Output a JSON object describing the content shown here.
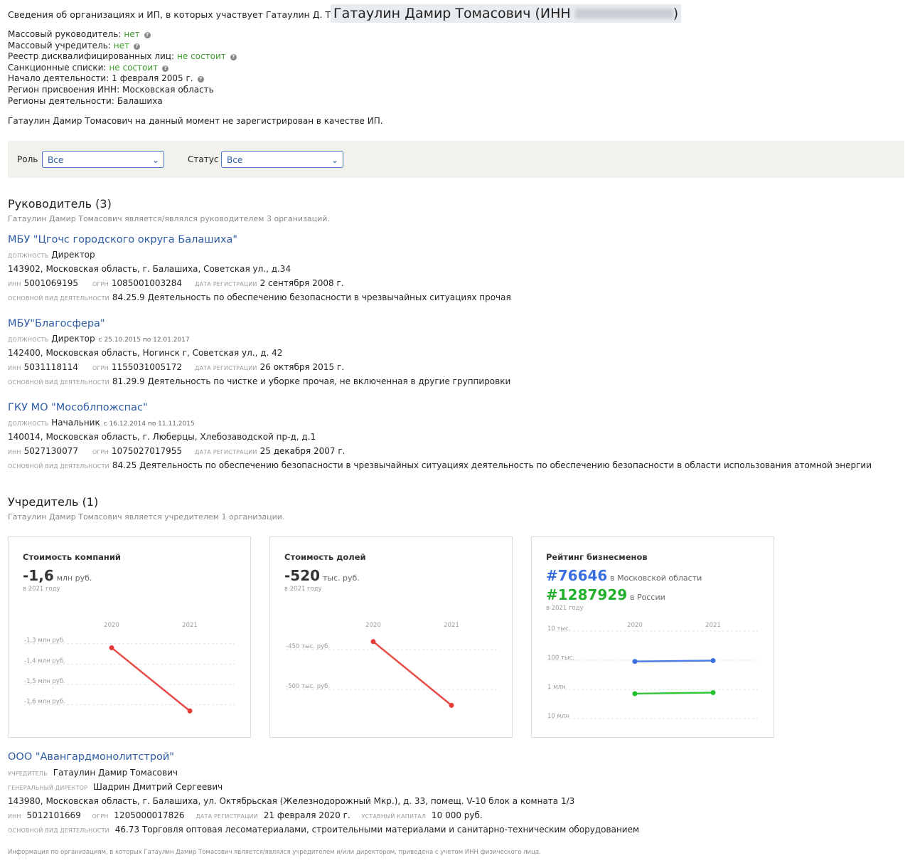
{
  "header": {
    "title": "Сведения об организациях и ИП, в которых участвует Гатаулин Д. Т.",
    "name_box": "Гатаулин Дамир Томасович (ИНН ",
    "name_box_close": ")"
  },
  "info": [
    {
      "label": "Массовый руководитель:",
      "value": "нет",
      "help": true
    },
    {
      "label": "Массовый учредитель:",
      "value": "нет",
      "help": true
    },
    {
      "label": "Реестр дисквалифицированных лиц:",
      "value": "не состоит",
      "help": true
    },
    {
      "label": "Санкционные списки:",
      "value": "не состоит",
      "help": true
    },
    {
      "label": "Начало деятельности:",
      "value": "1 февраля 2005 г.",
      "help": true
    },
    {
      "label": "Регион присвоения ИНН:",
      "value": "Московская область",
      "help": false
    },
    {
      "label": "Регионы деятельности:",
      "value": "Балашиха",
      "help": false
    }
  ],
  "ip_note": "Гатаулин Дамир Томасович на данный момент не зарегистрирован в качестве ИП.",
  "filters": {
    "role_label": "Роль",
    "role_value": "Все",
    "status_label": "Статус",
    "status_value": "Все"
  },
  "directors": {
    "heading": "Руководитель (3)",
    "sub": "Гатаулин Дамир Томасович является/являлся руководителем 3 организаций.",
    "orgs": [
      {
        "name": "МБУ \"Цгочс городского округа Балашиха\"",
        "position_cap": "должность",
        "position": "Директор",
        "period": "",
        "address": "143902, Московская область, г. Балашиха, Советская ул., д.34",
        "inn_cap": "инн",
        "inn": "5001069195",
        "ogrn_cap": "огрн",
        "ogrn": "1085001003284",
        "reg_cap": "дата регистрации",
        "reg": "2 сентября 2008 г.",
        "act_cap": "основной вид деятельности",
        "act": "84.25.9 Деятельность по обеспечению безопасности в чрезвычайных ситуациях прочая"
      },
      {
        "name": "МБУ\"Благосфера\"",
        "position_cap": "должность",
        "position": "Директор",
        "period": "с 25.10.2015 по 12.01.2017",
        "address": "142400, Московская область, Ногинск г, Советская ул., д. 42",
        "inn_cap": "инн",
        "inn": "5031118114",
        "ogrn_cap": "огрн",
        "ogrn": "1155031005172",
        "reg_cap": "дата регистрации",
        "reg": "26 октября 2015 г.",
        "act_cap": "основной вид деятельности",
        "act": "81.29.9 Деятельность по чистке и уборке прочая, не включенная в другие группировки"
      },
      {
        "name": "ГКУ МО \"Мособлпожспас\"",
        "position_cap": "должность",
        "position": "Начальник",
        "period": "с 16.12.2014 по 11.11.2015",
        "address": "140014, Московская область, г. Люберцы, Хлебозаводской пр-д, д.1",
        "inn_cap": "инн",
        "inn": "5027130077",
        "ogrn_cap": "огрн",
        "ogrn": "1075027017955",
        "reg_cap": "дата регистрации",
        "reg": "25 декабря 2007 г.",
        "act_cap": "основной вид деятельности",
        "act": "84.25 Деятельность по обеспечению безопасности в чрезвычайных ситуациях деятельность по обеспечению безопасности в области использования атомной энергии"
      }
    ]
  },
  "founders": {
    "heading": "Учредитель (1)",
    "sub": "Гатаулин Дамир Томасович является учредителем 1 организации."
  },
  "cards": [
    {
      "title": "Стоимость компаний",
      "big": "-1,6",
      "unit": "млн руб.",
      "year_note": "в 2021 году",
      "x_labels": [
        "2020",
        "2021"
      ],
      "y_labels": [
        "-1,3 млн руб.",
        "-1,4 млн руб.",
        "-1,5 млн руб.",
        "-1,6 млн руб."
      ]
    },
    {
      "title": "Стоимость долей",
      "big": "-520",
      "unit": "тыс. руб.",
      "year_note": "в 2021 году",
      "x_labels": [
        "2020",
        "2021"
      ],
      "y_labels": [
        "-450 тыс. руб.",
        "-500 тыс. руб."
      ]
    },
    {
      "title": "Рейтинг бизнесменов",
      "rank1": "#76646",
      "rank1_note": "в Московской области",
      "rank2": "#1287929",
      "rank2_note": "в России",
      "year_note": "в 2021 году",
      "x_labels": [
        "2020",
        "2021"
      ],
      "y_labels": [
        "10 тыс.",
        "100 тыс.",
        "1 млн",
        "10 млн"
      ]
    }
  ],
  "chart_data": [
    {
      "type": "line",
      "title": "Стоимость компаний",
      "x": [
        "2020",
        "2021"
      ],
      "series": [
        {
          "values": [
            -1.32,
            -1.63
          ],
          "color": "#e53935"
        }
      ],
      "ylabel": "млн руб.",
      "ylim": [
        -1.65,
        -1.28
      ]
    },
    {
      "type": "line",
      "title": "Стоимость долей",
      "x": [
        "2020",
        "2021"
      ],
      "series": [
        {
          "values": [
            -440,
            -520
          ],
          "color": "#e53935"
        }
      ],
      "ylabel": "тыс. руб."
    },
    {
      "type": "line",
      "title": "Рейтинг бизнесменов",
      "x": [
        "2020",
        "2021"
      ],
      "log_scale": true,
      "series": [
        {
          "values": [
            110000,
            103000
          ],
          "color": "#3b6fe0"
        },
        {
          "values": [
            1400000,
            1287929
          ],
          "color": "#22c02a"
        }
      ]
    }
  ],
  "founder_org": {
    "name": "ООО \"Авангардмонолитстрой\"",
    "founder_cap": "учредитель",
    "founder": "Гатаулин Дамир Томасович",
    "gd_cap": "генеральный директор",
    "gd": "Шадрин Дмитрий Сергеевич",
    "address": "143980, Московская область, г. Балашиха, ул. Октябрьская (Железнодорожный Мкр.), д. 33, помещ. V-10 блок а комната 1/3",
    "inn_cap": "инн",
    "inn": "5012101669",
    "ogrn_cap": "огрн",
    "ogrn": "1205000017826",
    "reg_cap": "дата регистрации",
    "reg": "21 февраля 2020 г.",
    "cap_cap": "уставный капитал",
    "cap": "10 000 руб.",
    "act_cap": "основной вид деятельности",
    "act": "46.73 Торговля оптовая лесоматериалами, строительными материалами и санитарно-техническим оборудованием"
  },
  "footer": "Информация по организациям, в которых Гатаулин Дамир Томасович является/являлся учредителем и/или директором, приведена с учетом ИНН физического лица."
}
